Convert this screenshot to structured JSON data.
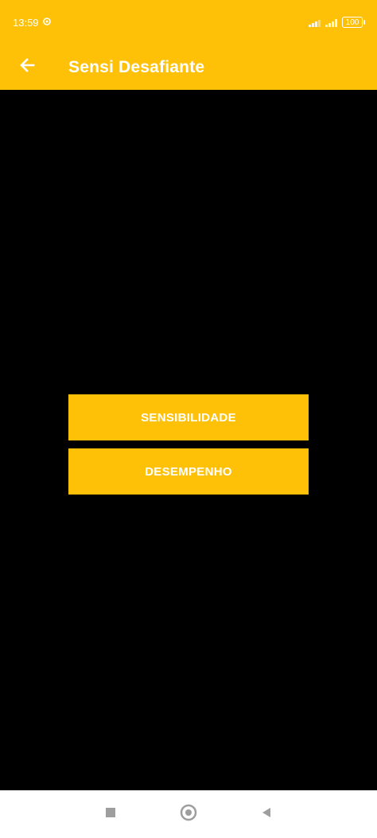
{
  "status_bar": {
    "time": "13:59",
    "battery": "100"
  },
  "app_bar": {
    "title": "Sensi Desafiante",
    "back_icon": "arrow-left-icon"
  },
  "main": {
    "buttons": [
      {
        "label": "SENSIBILIDADE"
      },
      {
        "label": "DESEMPENHO"
      }
    ]
  },
  "nav_bar": {
    "icons": [
      "recents-square-icon",
      "home-circle-icon",
      "back-triangle-icon"
    ]
  },
  "colors": {
    "accent": "#FFC107",
    "background": "#000000",
    "text_on_accent": "#FFFFFF",
    "nav_background": "#FFFFFF"
  }
}
